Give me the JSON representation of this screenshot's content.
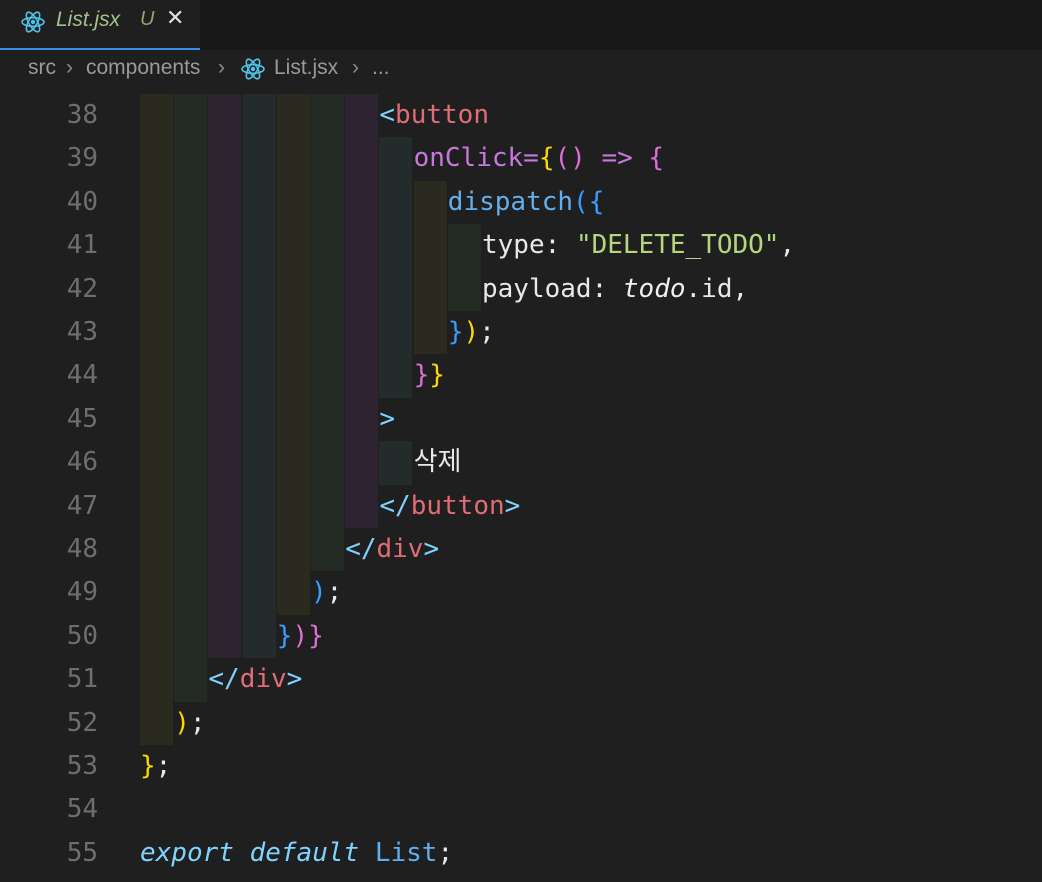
{
  "tab": {
    "title": "List.jsx",
    "status": "U",
    "close": "✕",
    "icon": "react-icon"
  },
  "breadcrumb": {
    "segments": [
      "src",
      "components",
      "List.jsx",
      "..."
    ]
  },
  "lines": [
    {
      "n": "38",
      "parts": [
        [
          "<",
          "t-br"
        ],
        [
          "button",
          "t-tag"
        ]
      ]
    },
    {
      "n": "39",
      "parts": [
        [
          "onClick",
          "t-attr"
        ],
        [
          "=",
          "t-op"
        ],
        [
          "{",
          "t-y"
        ],
        [
          "()",
          "t-m"
        ],
        [
          " => ",
          "t-op"
        ],
        [
          "{",
          "t-m"
        ]
      ]
    },
    {
      "n": "40",
      "parts": [
        [
          "dispatch",
          "t-fn"
        ],
        [
          "(",
          "t-b"
        ],
        [
          "{",
          "t-b"
        ]
      ]
    },
    {
      "n": "41",
      "parts": [
        [
          "type",
          "t-w"
        ],
        [
          ": ",
          "t-w"
        ],
        [
          "\"DELETE_TODO\"",
          "t-str"
        ],
        [
          ",",
          "t-w"
        ]
      ]
    },
    {
      "n": "42",
      "parts": [
        [
          "payload",
          "t-w"
        ],
        [
          ": ",
          "t-w"
        ],
        [
          "todo",
          "t-it"
        ],
        [
          ".id",
          "t-w"
        ],
        [
          ",",
          "t-w"
        ]
      ]
    },
    {
      "n": "43",
      "parts": [
        [
          "}",
          "t-b"
        ],
        [
          ")",
          "t-y"
        ],
        [
          ";",
          "t-w"
        ]
      ]
    },
    {
      "n": "44",
      "parts": [
        [
          "}",
          "t-m"
        ],
        [
          "}",
          "t-y"
        ]
      ]
    },
    {
      "n": "45",
      "parts": [
        [
          ">",
          "t-br"
        ]
      ]
    },
    {
      "n": "46",
      "parts": [
        [
          "삭제",
          "t-w"
        ]
      ]
    },
    {
      "n": "47",
      "parts": [
        [
          "</",
          "t-br"
        ],
        [
          "button",
          "t-tag"
        ],
        [
          ">",
          "t-br"
        ]
      ]
    },
    {
      "n": "48",
      "parts": [
        [
          "</",
          "t-br"
        ],
        [
          "div",
          "t-tag"
        ],
        [
          ">",
          "t-br"
        ]
      ]
    },
    {
      "n": "49",
      "parts": [
        [
          ")",
          "t-b"
        ],
        [
          ";",
          "t-w"
        ]
      ]
    },
    {
      "n": "50",
      "parts": [
        [
          "}",
          "t-b"
        ],
        [
          ")",
          "t-m"
        ],
        [
          "}",
          "t-m"
        ]
      ]
    },
    {
      "n": "51",
      "parts": [
        [
          "</",
          "t-br"
        ],
        [
          "div",
          "t-tag"
        ],
        [
          ">",
          "t-br"
        ]
      ]
    },
    {
      "n": "52",
      "parts": [
        [
          ")",
          "t-y"
        ],
        [
          ";",
          "t-w"
        ]
      ]
    },
    {
      "n": "53",
      "parts": [
        [
          "}",
          "t-y"
        ],
        [
          ";",
          "t-w"
        ]
      ]
    },
    {
      "n": "54",
      "parts": []
    },
    {
      "n": "55",
      "parts": [
        [
          "export",
          "t-kw"
        ],
        [
          " ",
          "t-w"
        ],
        [
          "default",
          "t-kw"
        ],
        [
          " ",
          "t-w"
        ],
        [
          "List",
          "t-cls"
        ],
        [
          ";",
          "t-w"
        ]
      ]
    }
  ]
}
